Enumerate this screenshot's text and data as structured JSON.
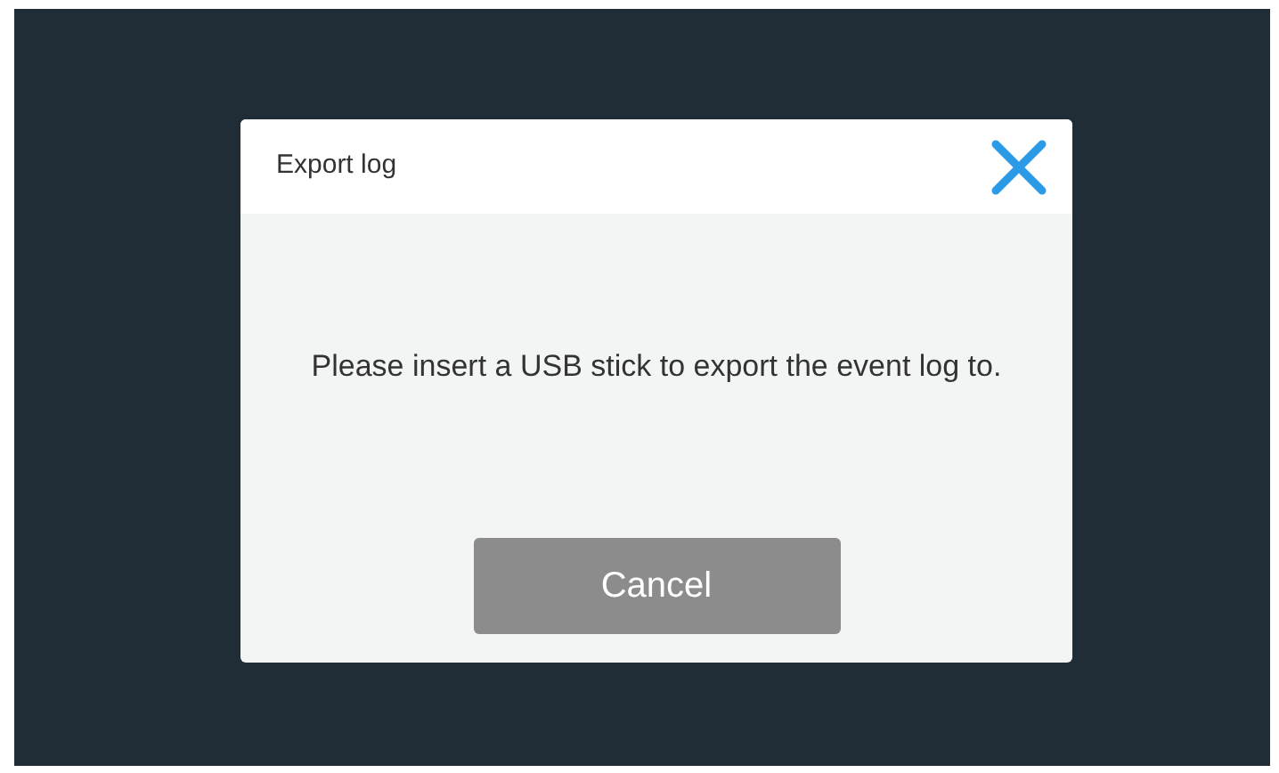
{
  "dialog": {
    "title": "Export log",
    "message": "Please insert a USB stick to export the event log to.",
    "buttons": [
      "Cancel"
    ]
  }
}
